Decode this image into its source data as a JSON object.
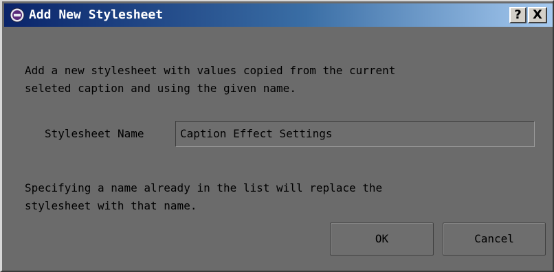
{
  "window": {
    "title": "Add New Stylesheet",
    "help_label": "?",
    "close_label": "X"
  },
  "description": {
    "line1": "Add a new stylesheet with values copied from the current",
    "line2": "seleted caption and using the given name."
  },
  "form": {
    "name_label": "Stylesheet Name",
    "name_value": "Caption Effect Settings"
  },
  "note": {
    "line1": "Specifying a name already in the list will replace the",
    "line2": "stylesheet with that name."
  },
  "buttons": {
    "ok_label": "OK",
    "cancel_label": "Cancel"
  }
}
